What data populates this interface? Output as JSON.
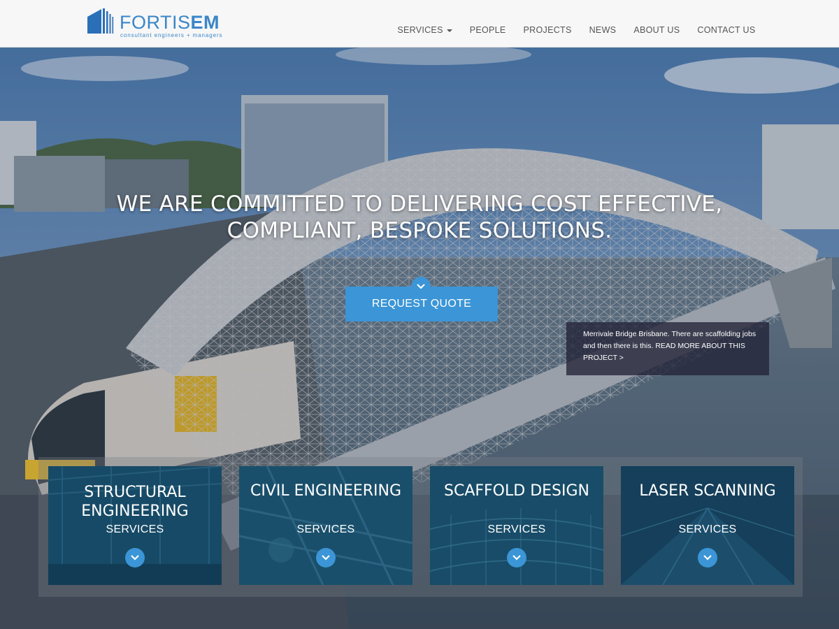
{
  "header": {
    "logo": {
      "word_thin": "FORTIS",
      "word_bold": "EM",
      "tagline": "consultant engineers + managers"
    },
    "nav": [
      {
        "label": "SERVICES",
        "dropdown": true
      },
      {
        "label": "PEOPLE"
      },
      {
        "label": "PROJECTS"
      },
      {
        "label": "NEWS"
      },
      {
        "label": "ABOUT US"
      },
      {
        "label": "CONTACT US"
      }
    ]
  },
  "hero": {
    "headline_line1": "WE ARE COMMITTED TO DELIVERING COST EFFECTIVE,",
    "headline_line2": "COMPLIANT, BESPOKE SOLUTIONS.",
    "cta_label": "REQUEST QUOTE",
    "caption_line1": "Merrivale Bridge Brisbane. There are scaffolding jobs",
    "caption_line2": "and then there is this.",
    "caption_link_a": "READ MORE ABOUT THIS",
    "caption_link_b": "PROJECT >"
  },
  "services": [
    {
      "title_line1": "STRUCTURAL",
      "title_line2": "ENGINEERING",
      "sub": "SERVICES"
    },
    {
      "title_line1": "CIVIL ENGINEERING",
      "title_line2": "",
      "sub": "SERVICES"
    },
    {
      "title_line1": "SCAFFOLD DESIGN",
      "title_line2": "",
      "sub": "SERVICES"
    },
    {
      "title_line1": "LASER SCANNING",
      "title_line2": "",
      "sub": "SERVICES"
    }
  ],
  "colors": {
    "accent": "#3b95d6",
    "logo": "#3a86c8",
    "caption_bg": "#23233a"
  }
}
